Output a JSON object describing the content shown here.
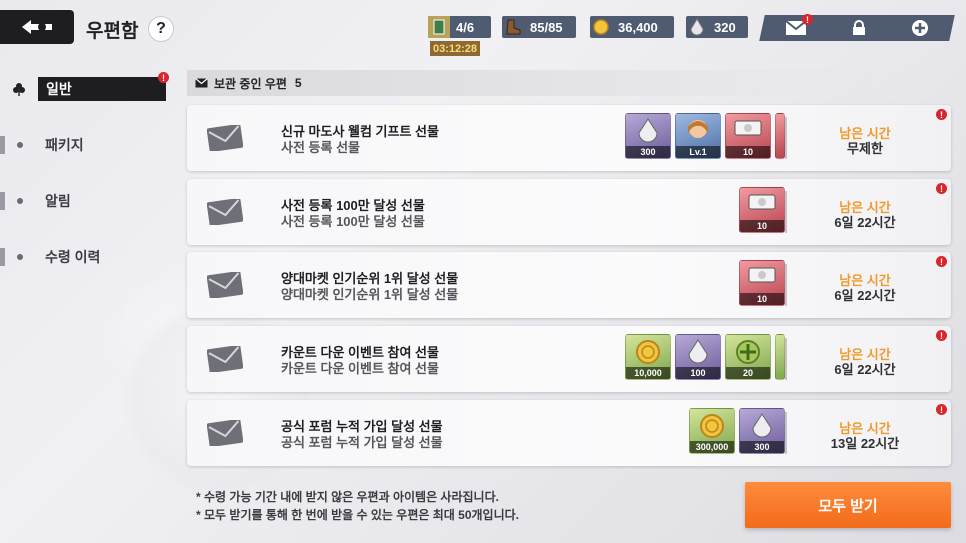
{
  "header": {
    "title": "우편함",
    "help_label": "?",
    "resources": [
      {
        "icon": "stamina-card-icon",
        "value": "4/6"
      },
      {
        "icon": "boots-icon",
        "value": "85/85"
      },
      {
        "icon": "gold-coin-icon",
        "value": "36,400"
      },
      {
        "icon": "crystal-drop-icon",
        "value": "320"
      }
    ],
    "timer": "03:12:28",
    "mail_badge": "!"
  },
  "sidebar": {
    "items": [
      {
        "label": "일반",
        "active": true,
        "badge": "!"
      },
      {
        "label": "패키지"
      },
      {
        "label": "알림"
      },
      {
        "label": "수령 이력"
      }
    ]
  },
  "list": {
    "header_label": "보관 중인 우편",
    "count": "5",
    "time_label": "남은 시간",
    "badge": "!",
    "mails": [
      {
        "title": "신규 마도사 웰컴 기프트 선물",
        "subtitle": "사전 등록 선물",
        "time": "무제한",
        "items": [
          {
            "icon": "crystal-icon",
            "bg": "purple",
            "qty": "300"
          },
          {
            "icon": "character-portrait-icon",
            "bg": "blue",
            "qty": "Lv.1"
          },
          {
            "icon": "ticket-icon",
            "bg": "red",
            "qty": "10"
          }
        ]
      },
      {
        "title": "사전 등록 100만 달성 선물",
        "subtitle": "사전 등록 100만 달성 선물",
        "time": "6일 22시간",
        "items": [
          {
            "icon": "ticket-icon",
            "bg": "red",
            "qty": "10"
          }
        ]
      },
      {
        "title": "양대마켓 인기순위 1위 달성 선물",
        "subtitle": "양대마켓 인기순위 1위 달성 선물",
        "time": "6일 22시간",
        "items": [
          {
            "icon": "ticket-icon",
            "bg": "red",
            "qty": "10"
          }
        ]
      },
      {
        "title": "카운트 다운 이벤트 참여 선물",
        "subtitle": "카운트 다운 이벤트 참여 선물",
        "time": "6일 22시간",
        "items": [
          {
            "icon": "gold-coin-icon",
            "bg": "green",
            "qty": "10,000"
          },
          {
            "icon": "crystal-icon",
            "bg": "purple",
            "qty": "100"
          },
          {
            "icon": "clover-emblem-icon",
            "bg": "green",
            "qty": "20"
          }
        ]
      },
      {
        "title": "공식 포럼 누적 가입 달성 선물",
        "subtitle": "공식 포럼 누적 가입 달성 선물",
        "time": "13일 22시간",
        "items": [
          {
            "icon": "gold-coin-icon",
            "bg": "green",
            "qty": "300,000"
          },
          {
            "icon": "crystal-icon",
            "bg": "purple",
            "qty": "300"
          }
        ]
      }
    ]
  },
  "footer": {
    "note1": "* 수령 가능 기간 내에 받지 않은 우편과 아이템은 사라집니다.",
    "note2": "* 모두 받기를 통해 한 번에 받을 수 있는 우편은 최대 50개입니다.",
    "claim_all_label": "모두 받기"
  },
  "colors": {
    "accent_orange": "#f26b1c",
    "time_label": "#f19a2b",
    "header_bar": "#4e5b70",
    "badge_red": "#d8262d"
  }
}
